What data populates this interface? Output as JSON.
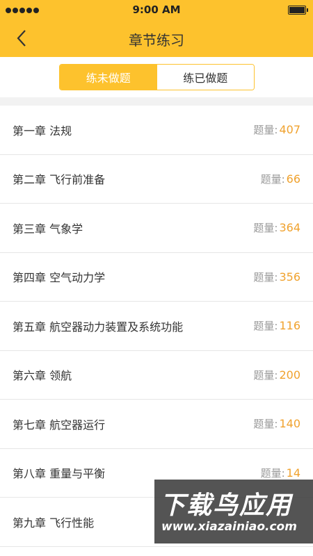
{
  "status_bar": {
    "time": "9:00 AM"
  },
  "header": {
    "title": "章节练习"
  },
  "tabs": [
    {
      "label": "练未做题",
      "active": true
    },
    {
      "label": "练已做题",
      "active": false
    }
  ],
  "chapters": [
    {
      "title": "第一章  法规",
      "count_label": "题量:",
      "count": "407"
    },
    {
      "title": "第二章  飞行前准备",
      "count_label": "题量:",
      "count": "66"
    },
    {
      "title": "第三章  气象学",
      "count_label": "题量:",
      "count": "364"
    },
    {
      "title": "第四章  空气动力学",
      "count_label": "题量:",
      "count": "356"
    },
    {
      "title": "第五章  航空器动力装置及系统功能",
      "count_label": "题量:",
      "count": "116"
    },
    {
      "title": "第六章  领航",
      "count_label": "题量:",
      "count": "200"
    },
    {
      "title": "第七章  航空器运行",
      "count_label": "题量:",
      "count": "140"
    },
    {
      "title": "第八章  重量与平衡",
      "count_label": "题量:",
      "count": "14"
    },
    {
      "title": "第九章  飞行性能",
      "count_label": "",
      "count": ""
    }
  ],
  "watermark": {
    "line1": "下载鸟应用",
    "line2": "www.xiazainiao.com"
  },
  "colors": {
    "accent": "#fdc22d",
    "count": "#f0a22e"
  }
}
